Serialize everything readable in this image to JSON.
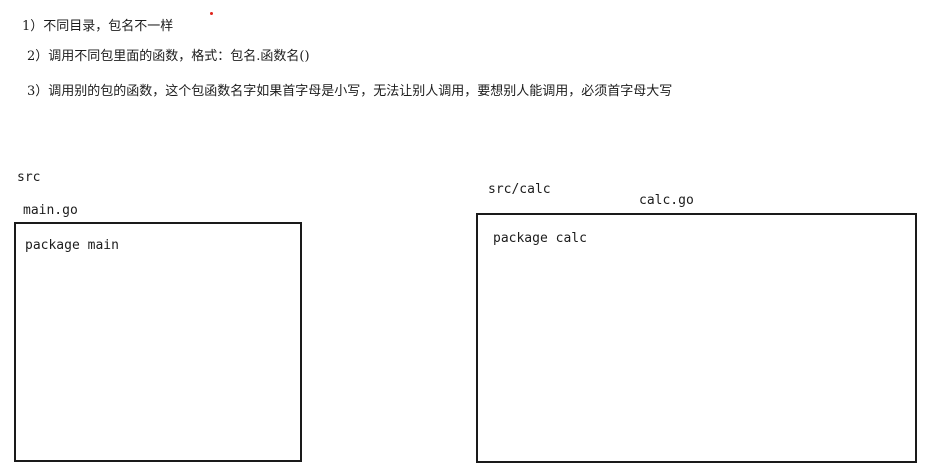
{
  "notes": [
    "1）不同目录，包名不一样",
    "2）调用不同包里面的函数，格式：包名.函数名()",
    "3）调用别的包的函数，这个包函数名字如果首字母是小写，无法让别人调用，要想别人能调用，必须首字母大写"
  ],
  "left_panel": {
    "dir_label": "src",
    "file_label": "main.go",
    "code": "package main"
  },
  "right_panel": {
    "dir_label": "src/calc",
    "file_label": "calc.go",
    "code": "package calc"
  },
  "colors": {
    "annotation_dot": "#e0241b",
    "box_border": "#1a1a1a"
  }
}
